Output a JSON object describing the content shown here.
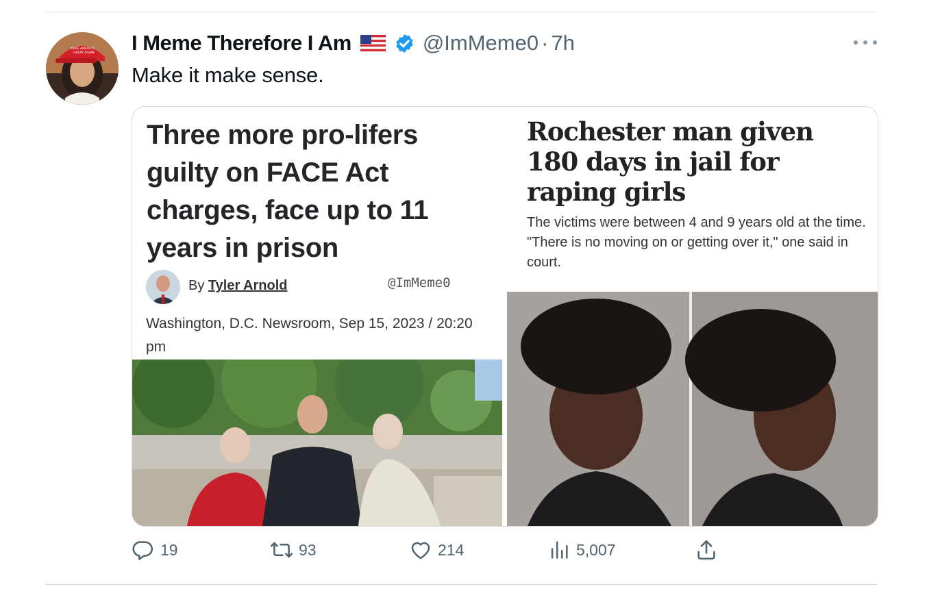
{
  "tweet": {
    "display_name": "I Meme Therefore I Am",
    "handle": "@ImMeme0",
    "separator": "·",
    "time": "7h",
    "text": "Make it make sense.",
    "avatar_hat_text": "MAKE AMERICA GREAT AGAIN"
  },
  "left_article": {
    "headline": "Three more pro-lifers guilty on FACE Act charges, face up to 11 years in prison",
    "by_prefix": "By",
    "author": "Tyler Arnold",
    "watermark": "@ImMeme0",
    "dateline": "Washington, D.C. Newsroom, Sep 15, 2023 / 20:20 pm"
  },
  "right_article": {
    "headline": "Rochester man given 180 days in jail for raping girls",
    "subhead": "The victims were between 4 and 9 years old at the time. \"There is no moving on or getting over it,\" one said in court."
  },
  "actions": {
    "replies": "19",
    "retweets": "93",
    "likes": "214",
    "views": "5,007"
  },
  "colors": {
    "muted": "#536471",
    "verified": "#1d9bf0",
    "divider": "#d5dbe0"
  },
  "icons": [
    "usa-flag-icon",
    "verified-badge-icon",
    "more-icon",
    "reply-icon",
    "retweet-icon",
    "like-icon",
    "views-icon",
    "share-icon"
  ]
}
